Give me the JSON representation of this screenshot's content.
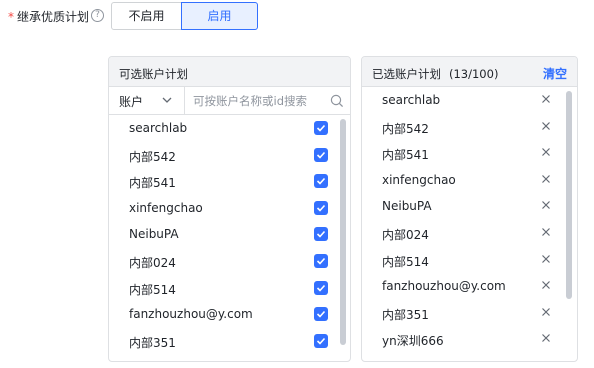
{
  "inherit": {
    "required_mark": "*",
    "label": "继承优质计划",
    "help_icon": "question-circle-icon",
    "options": [
      {
        "label": "不启用",
        "selected": false
      },
      {
        "label": "启用",
        "selected": true
      }
    ]
  },
  "available": {
    "title": "可选账户计划",
    "filter_value": "账户",
    "search_placeholder": "可按账户名称或id搜索",
    "items": [
      {
        "label": "searchlab",
        "checked": true
      },
      {
        "label": "内部542",
        "checked": true
      },
      {
        "label": "内部541",
        "checked": true
      },
      {
        "label": "xinfengchao",
        "checked": true
      },
      {
        "label": "NeibuPA",
        "checked": true
      },
      {
        "label": "内部024",
        "checked": true
      },
      {
        "label": "内部514",
        "checked": true
      },
      {
        "label": "fanzhouzhou@y.com",
        "checked": true
      },
      {
        "label": "内部351",
        "checked": true
      }
    ]
  },
  "selected": {
    "title": "已选账户计划",
    "count": "(13/100)",
    "clear_label": "清空",
    "items": [
      {
        "label": "searchlab"
      },
      {
        "label": "内部542"
      },
      {
        "label": "内部541"
      },
      {
        "label": "xinfengchao"
      },
      {
        "label": "NeibuPA"
      },
      {
        "label": "内部024"
      },
      {
        "label": "内部514"
      },
      {
        "label": "fanzhouzhou@y.com"
      },
      {
        "label": "内部351"
      },
      {
        "label": "yn深圳666"
      }
    ]
  },
  "colors": {
    "accent": "#3370ff",
    "required": "#f54a45",
    "border": "#dee0e3",
    "header_bg": "#f2f3f5"
  }
}
